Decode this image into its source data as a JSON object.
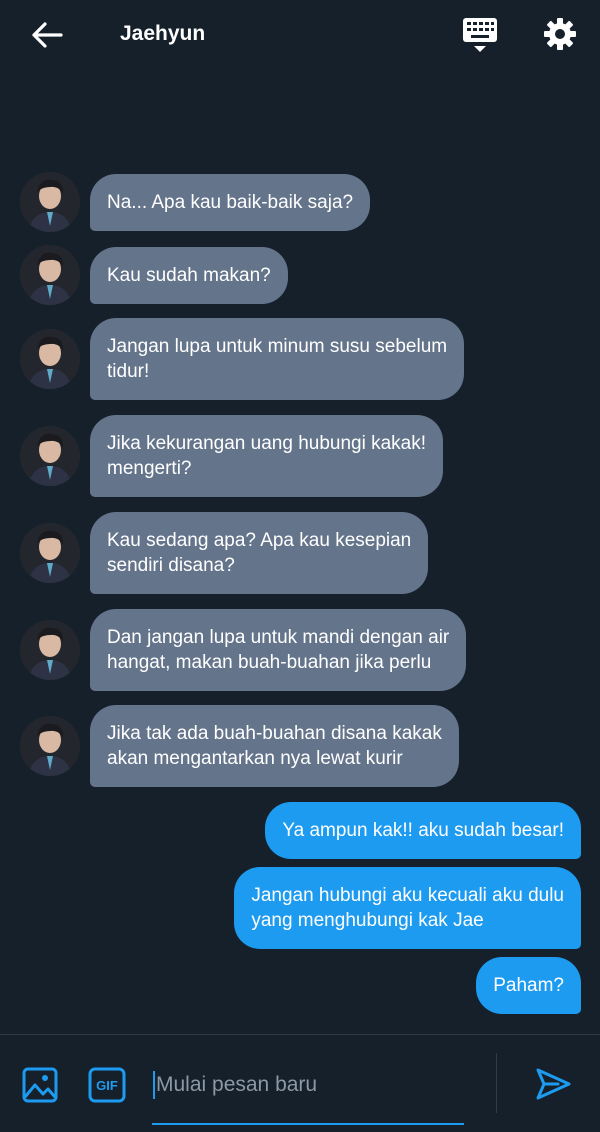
{
  "header": {
    "title": "Jaehyun",
    "back_icon": "arrow-left-icon",
    "keyboard_icon": "keyboard-icon",
    "settings_icon": "gear-icon"
  },
  "messages": {
    "incoming": [
      {
        "text": "Na... Apa kau baik-baik saja?"
      },
      {
        "text": "Kau sudah makan?"
      },
      {
        "text": "Jangan lupa untuk minum susu sebelum\ntidur!"
      },
      {
        "text": "Jika kekurangan uang hubungi kakak!\nmengerti?"
      },
      {
        "text": "Kau sedang apa? Apa kau kesepian\nsendiri disana?"
      },
      {
        "text": "Dan jangan lupa untuk mandi dengan air\nhangat, makan buah-buahan jika perlu"
      },
      {
        "text": "Jika tak ada buah-buahan disana kakak\nakan mengantarkan nya lewat kurir"
      }
    ],
    "outgoing": [
      {
        "text": "Ya ampun kak!! aku sudah besar!"
      },
      {
        "text": "Jangan hubungi aku kecuali aku dulu\nyang menghubungi kak Jae"
      },
      {
        "text": "Paham?"
      }
    ]
  },
  "composer": {
    "placeholder": "Mulai pesan baru",
    "value": "",
    "gif_label": "GIF",
    "media_icon": "image-icon",
    "send_icon": "send-icon"
  },
  "colors": {
    "background": "#15202b",
    "incoming_bubble": "#64748b",
    "outgoing_bubble": "#1d9bf0",
    "accent": "#1d9bf0"
  }
}
